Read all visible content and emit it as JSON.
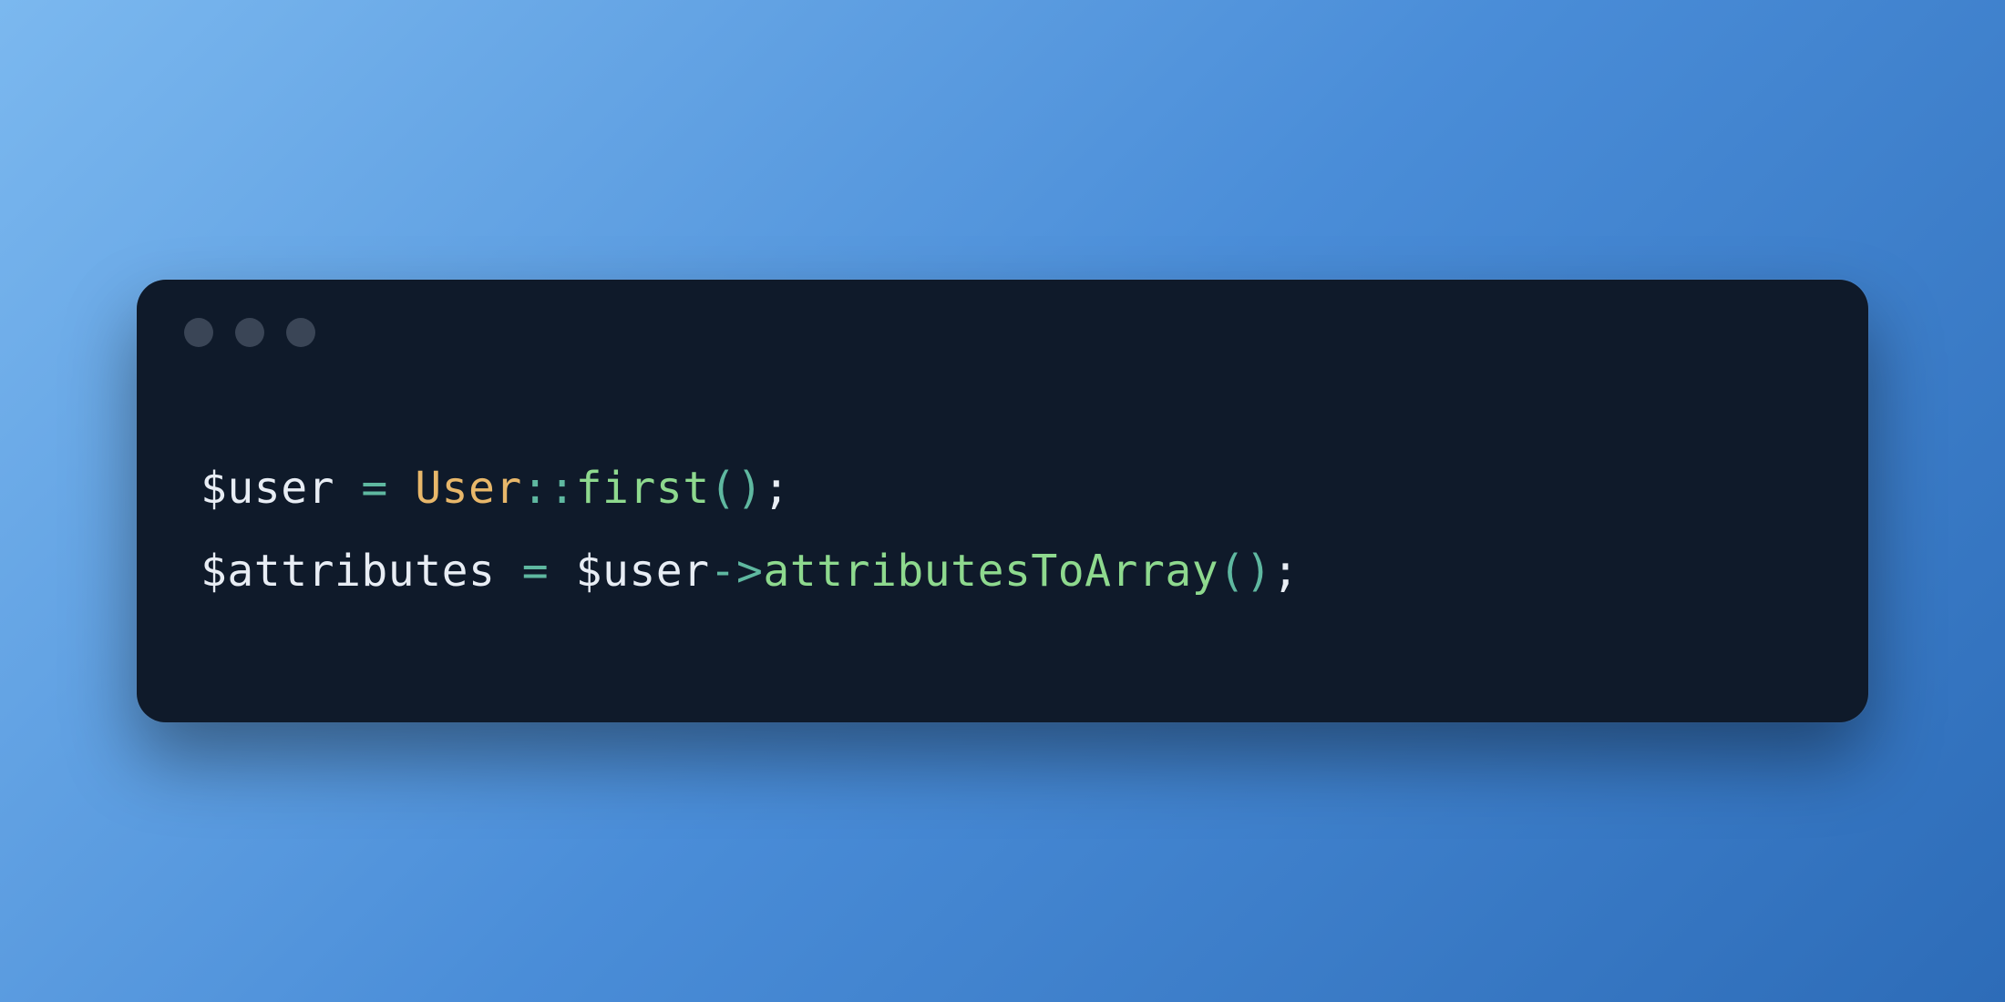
{
  "colors": {
    "bg_gradient_start": "#7bb8ef",
    "bg_gradient_end": "#2d6cb8",
    "window_bg": "#0f1a2a",
    "traffic_light": "#3a4556",
    "tok_default": "#e8edf4",
    "tok_class": "#e8b76a",
    "tok_operator": "#5fb8a0",
    "tok_method": "#8ed98e"
  },
  "code": {
    "lines": [
      {
        "tokens": [
          {
            "text": "$user ",
            "cls": "tok-default"
          },
          {
            "text": "=",
            "cls": "tok-operator"
          },
          {
            "text": " ",
            "cls": "tok-default"
          },
          {
            "text": "User",
            "cls": "tok-class"
          },
          {
            "text": "::",
            "cls": "tok-operator"
          },
          {
            "text": "first",
            "cls": "tok-method"
          },
          {
            "text": "()",
            "cls": "tok-paren"
          },
          {
            "text": ";",
            "cls": "tok-semi"
          }
        ]
      },
      {
        "tokens": [
          {
            "text": "$attributes ",
            "cls": "tok-default"
          },
          {
            "text": "=",
            "cls": "tok-operator"
          },
          {
            "text": " $user",
            "cls": "tok-default"
          },
          {
            "text": "->",
            "cls": "tok-operator"
          },
          {
            "text": "attributesToArray",
            "cls": "tok-method"
          },
          {
            "text": "()",
            "cls": "tok-paren"
          },
          {
            "text": ";",
            "cls": "tok-semi"
          }
        ]
      }
    ]
  }
}
